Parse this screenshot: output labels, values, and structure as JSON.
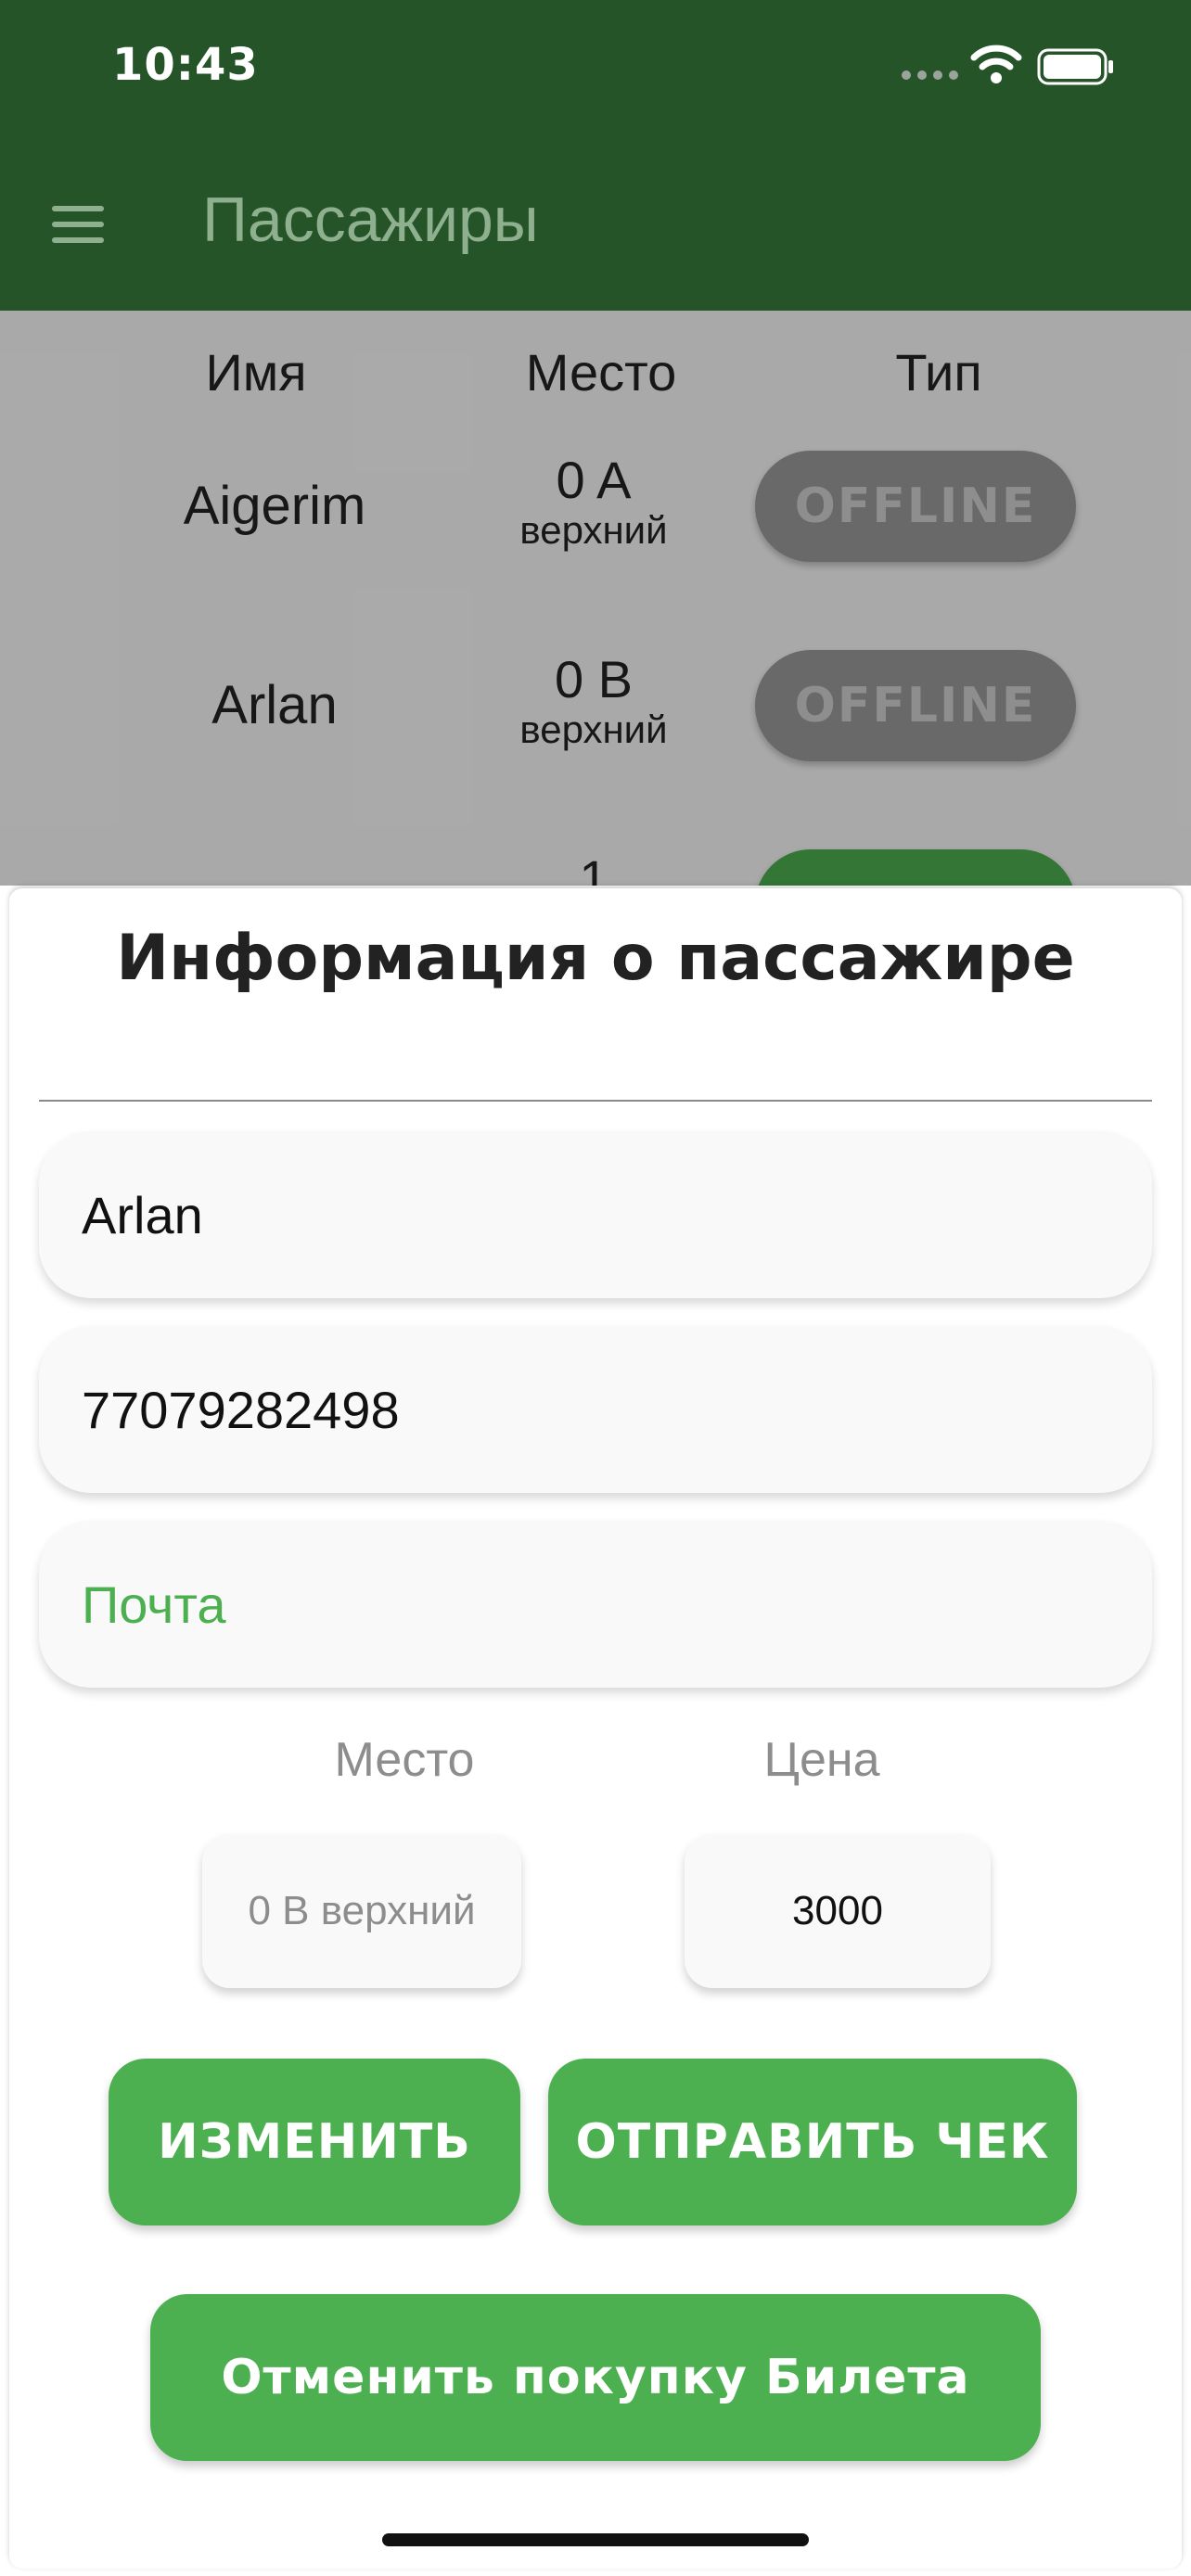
{
  "status_bar": {
    "time": "10:43"
  },
  "app_bar": {
    "title": "Пассажиры"
  },
  "table": {
    "headers": [
      "Имя",
      "Место",
      "Тип"
    ],
    "rows": [
      {
        "name": "Aigerim",
        "seat": "0 A",
        "berth": "верхний",
        "type": "OFFLINE"
      },
      {
        "name": "Arlan",
        "seat": "0 B",
        "berth": "верхний",
        "type": "OFFLINE"
      },
      {
        "name": "",
        "seat": "1",
        "berth": "",
        "type": ""
      }
    ]
  },
  "sheet": {
    "title": "Информация о пассажире",
    "name_value": "Arlan",
    "phone_value": "77079282498",
    "email_placeholder": "Почта",
    "seat_label": "Место",
    "price_label": "Цена",
    "seat_value": "0 B верхний",
    "price_value": "3000",
    "edit_button": "ИЗМЕНИТЬ",
    "send_receipt_button": "ОТПРАВИТЬ ЧЕК",
    "cancel_button": "Отменить покупку Билета"
  },
  "colors": {
    "appbar": "#255428",
    "accent": "#4caf50"
  }
}
